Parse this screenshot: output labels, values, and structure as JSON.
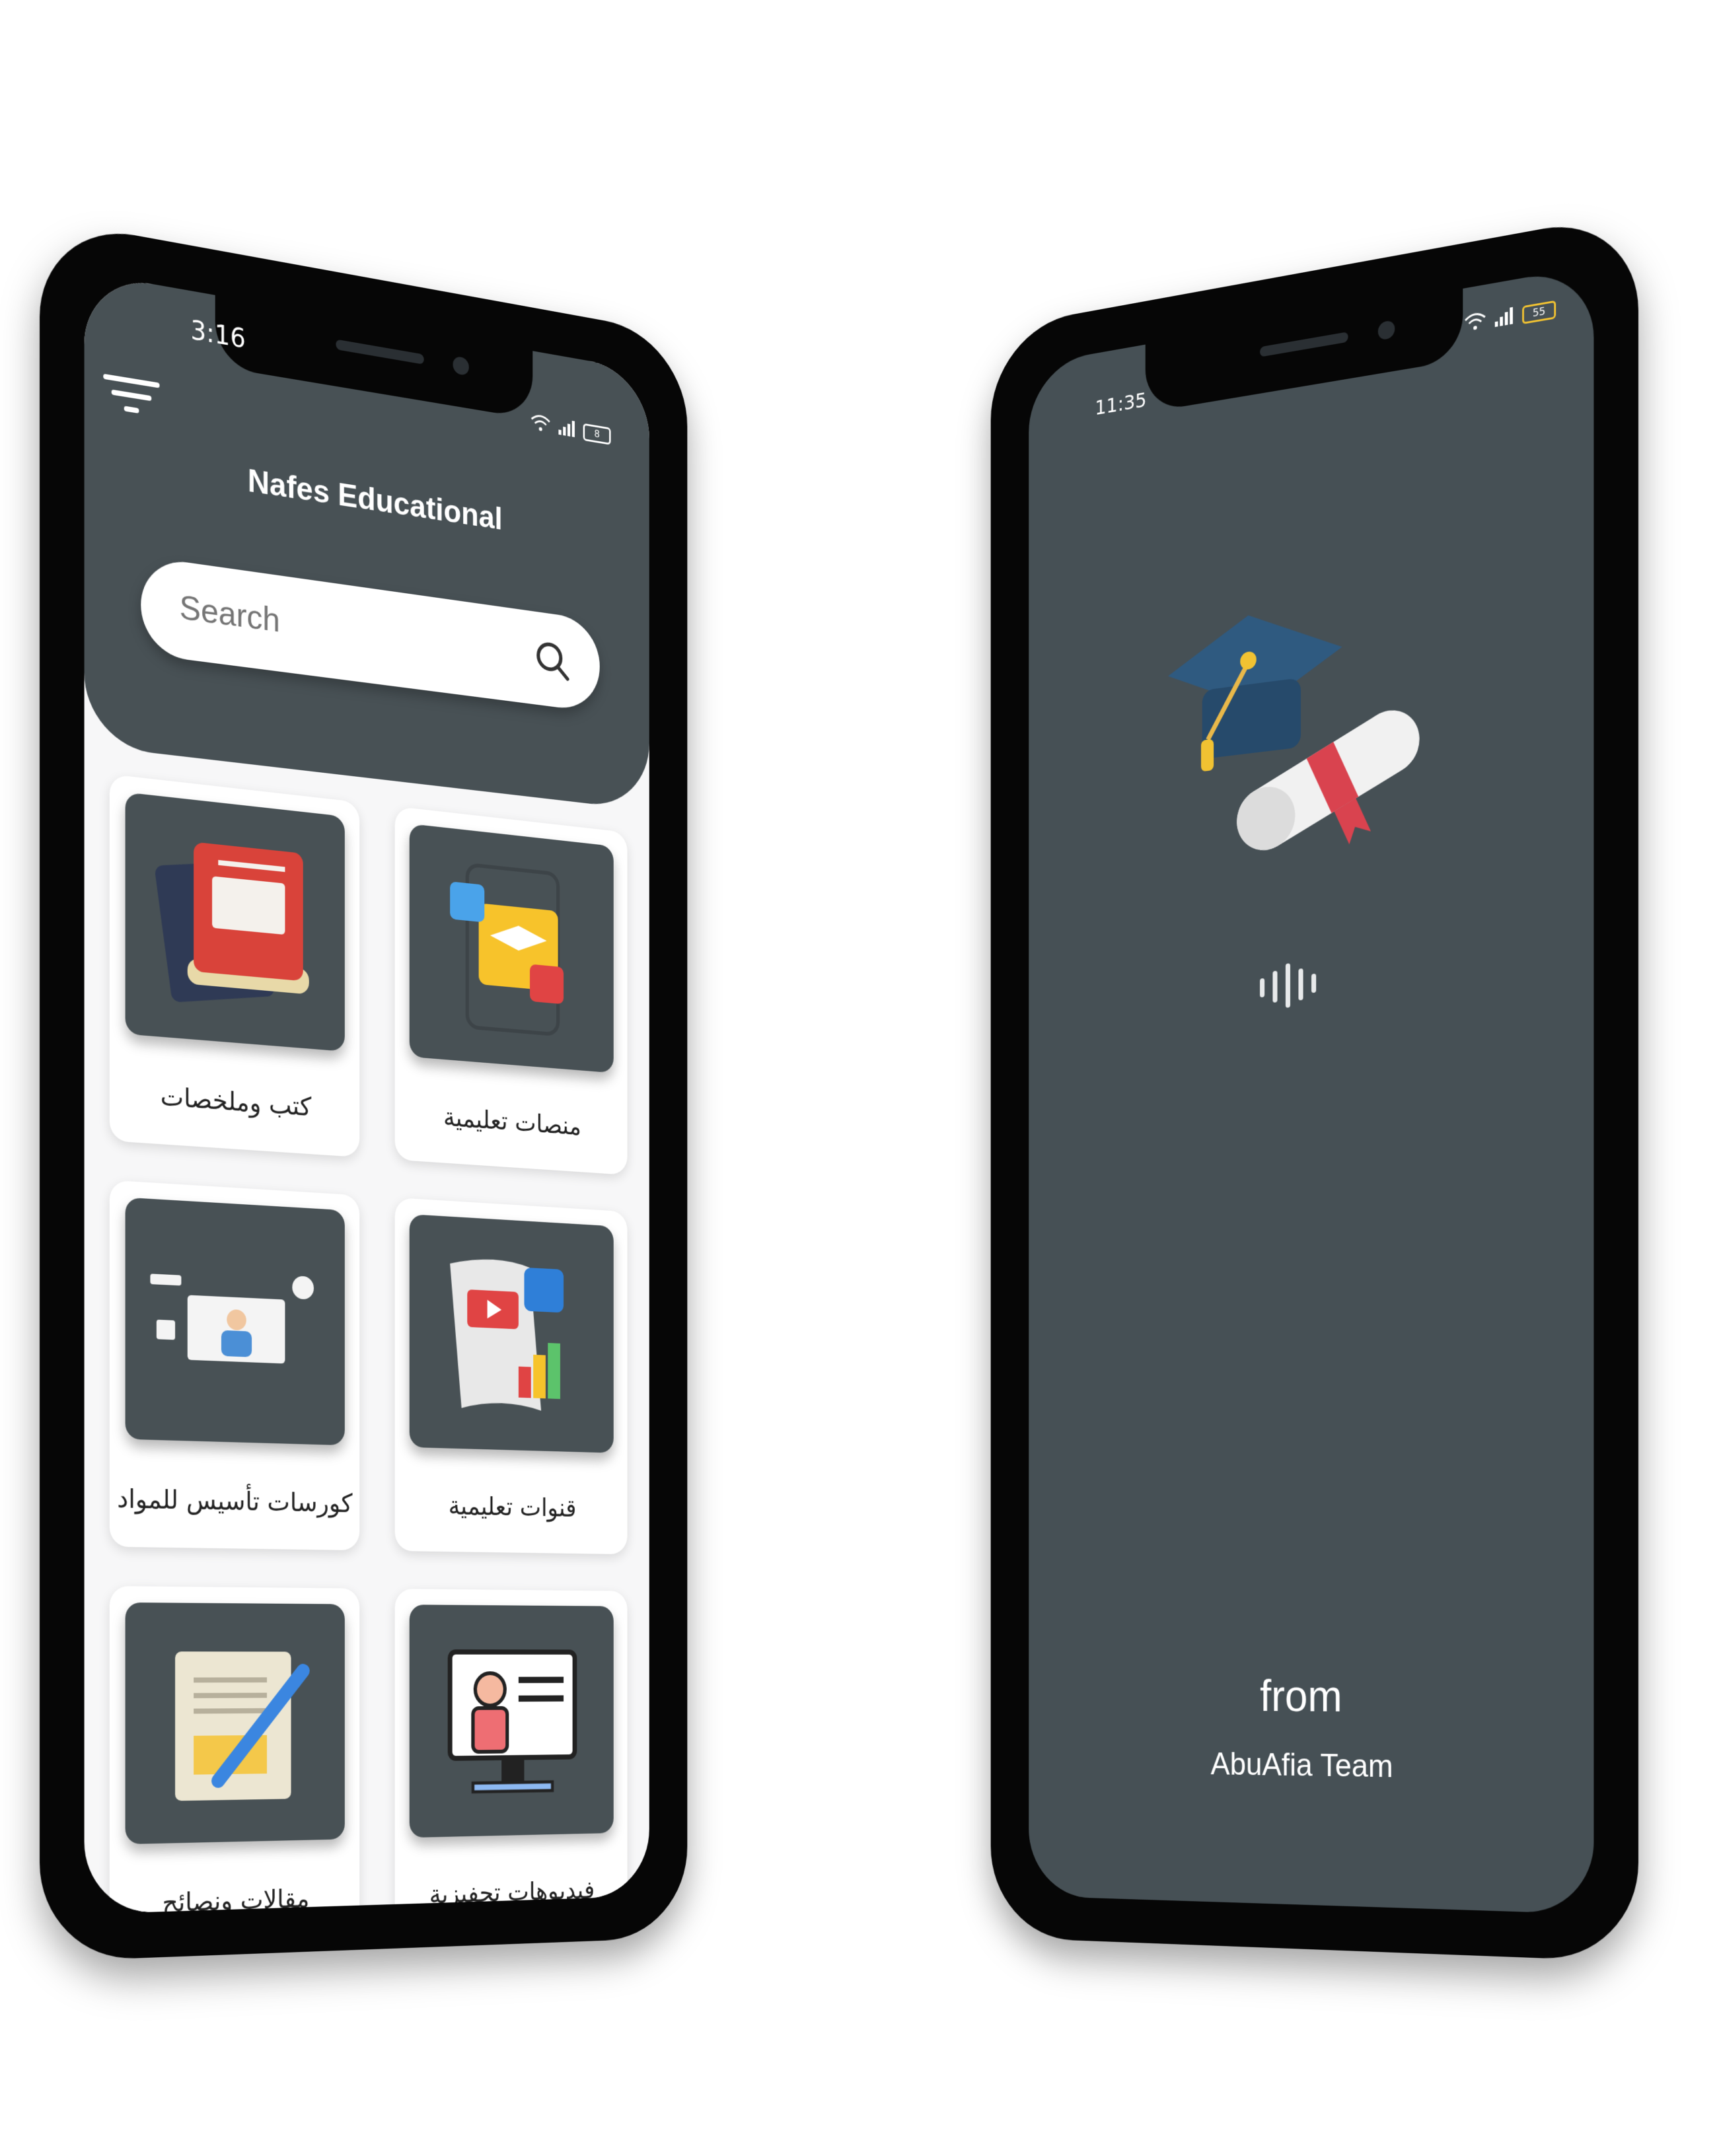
{
  "left_phone": {
    "status": {
      "time": "3:16",
      "battery": "8"
    },
    "app_title": "Nafes Educational",
    "search": {
      "placeholder": "Search"
    },
    "cards": [
      {
        "label": "كتب وملخصات",
        "icon": "book-icon"
      },
      {
        "label": "منصات تعليمية",
        "icon": "phone-graduation-icon"
      },
      {
        "label": "كورسات تأسيس للمواد",
        "icon": "online-course-icon"
      },
      {
        "label": "قنوات تعليمية",
        "icon": "video-channel-icon"
      },
      {
        "label": "مقالات ونصائح",
        "icon": "article-pen-icon"
      },
      {
        "label": "فيديوهات تحفيزية",
        "icon": "teacher-screen-icon"
      }
    ]
  },
  "right_phone": {
    "status": {
      "time": "11:35",
      "battery": "55"
    },
    "splash_icon": "graduation-cap-diploma-icon",
    "from_text": "from",
    "team_text": "AbuAfia Team"
  },
  "colors": {
    "header_bg": "#485155",
    "splash_bg": "#465055",
    "screen_bg": "#f7f7f8",
    "card_bg": "#ffffff"
  }
}
